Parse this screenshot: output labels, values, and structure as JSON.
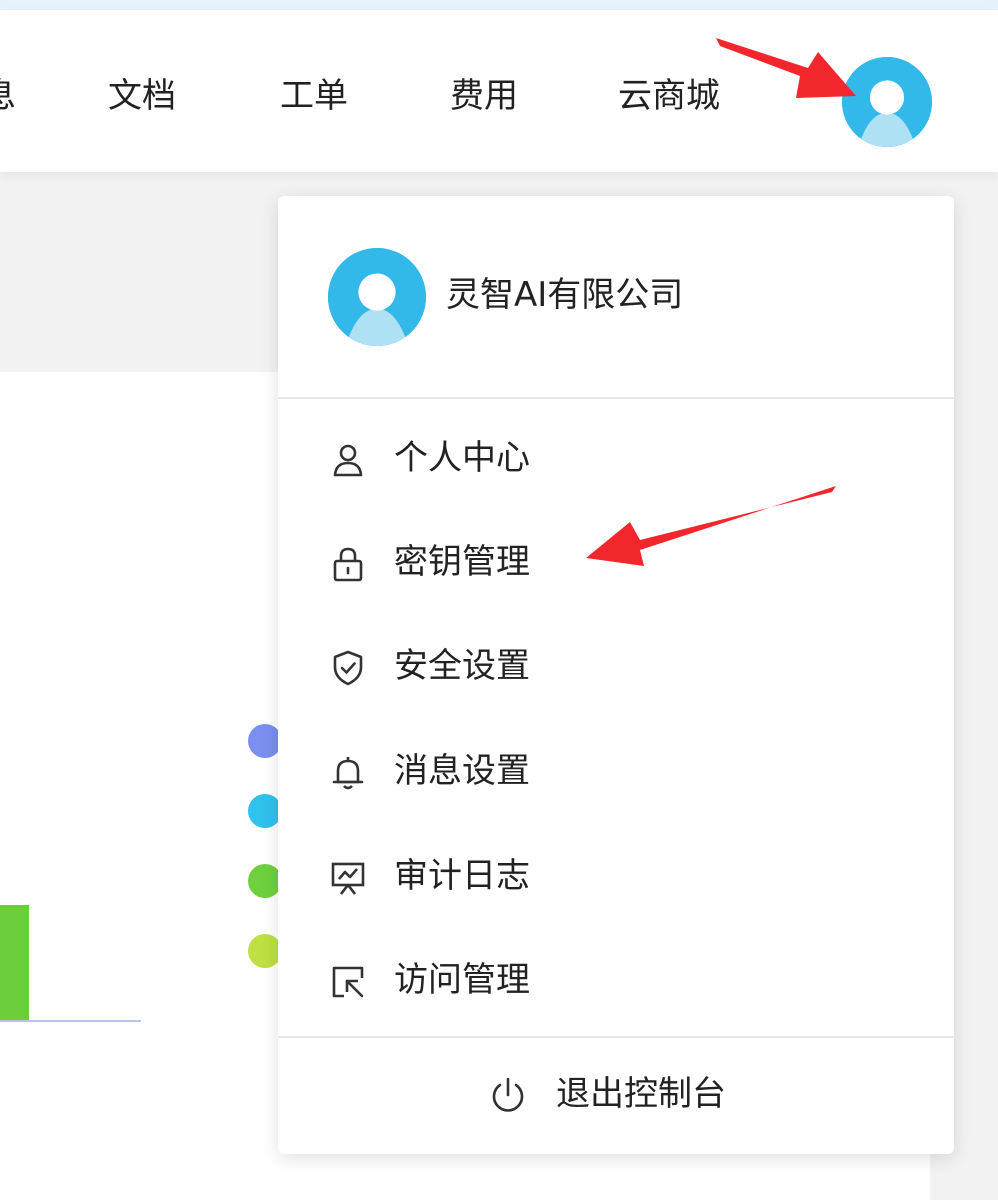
{
  "header": {
    "nav": [
      {
        "label": "息"
      },
      {
        "label": "文档"
      },
      {
        "label": "工单"
      },
      {
        "label": "费用"
      },
      {
        "label": "云商城"
      }
    ],
    "avatar_icon": "user-avatar-icon"
  },
  "dropdown": {
    "org_name": "灵智AI有限公司",
    "items": [
      {
        "label": "个人中心",
        "icon": "user-icon"
      },
      {
        "label": "密钥管理",
        "icon": "lock-icon"
      },
      {
        "label": "安全设置",
        "icon": "shield-check-icon"
      },
      {
        "label": "消息设置",
        "icon": "bell-icon"
      },
      {
        "label": "审计日志",
        "icon": "monitor-chart-icon"
      },
      {
        "label": "访问管理",
        "icon": "access-arrow-icon"
      }
    ],
    "logout": {
      "label": "退出控制台",
      "icon": "power-icon"
    }
  },
  "colors": {
    "avatar_bg": "#33b8ea",
    "legend": [
      "#7b8ff0",
      "#2fc2ec",
      "#6fd03d",
      "#bde042"
    ],
    "annotation_arrow": "#f2262d"
  }
}
